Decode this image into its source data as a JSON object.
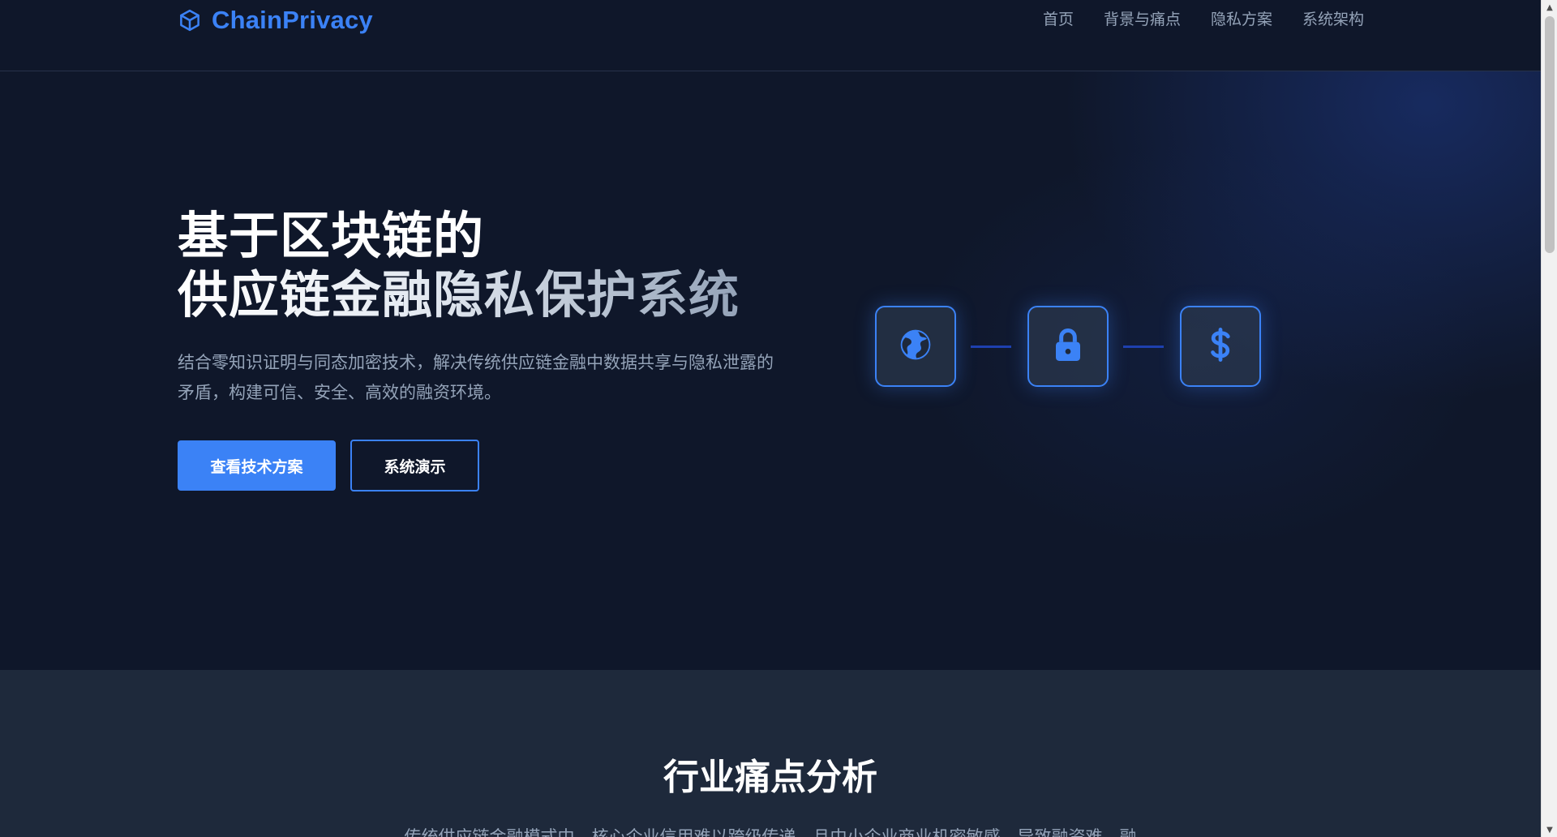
{
  "nav": {
    "brand": "ChainPrivacy",
    "brand_icon": "cube-icon",
    "links": [
      "首页",
      "背景与痛点",
      "隐私方案",
      "系统架构"
    ]
  },
  "hero": {
    "title_line1": "基于区块链的",
    "title_line2": "供应链金融隐私保护系统",
    "subtitle": "结合零知识证明与同态加密技术，解决传统供应链金融中数据共享与隐私泄露的矛盾，构建可信、安全、高效的融资环境。",
    "primary_button": "查看技术方案",
    "secondary_button": "系统演示",
    "flow_icons": [
      "globe-icon",
      "lock-icon",
      "dollar-icon"
    ]
  },
  "pain": {
    "title": "行业痛点分析",
    "description": "传统供应链金融模式中，核心企业信用难以跨级传递，且中小企业商业机密敏感，导致融资难、融"
  },
  "colors": {
    "background": "#0f172a",
    "accent": "#3b82f6",
    "section_alt": "#1e293b",
    "muted_text": "#94a3b8"
  }
}
